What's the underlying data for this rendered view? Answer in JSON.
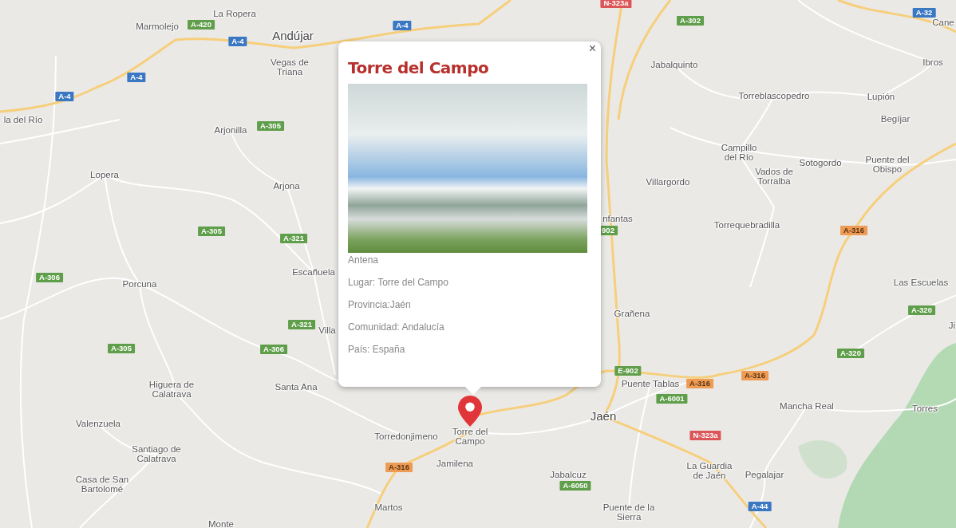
{
  "map": {
    "places": [
      {
        "name": "La Ropera",
        "kind": "town"
      },
      {
        "name": "Marmolejo",
        "kind": "town"
      },
      {
        "name": "Cane",
        "kind": "town"
      },
      {
        "name": "Andújar",
        "kind": "city"
      },
      {
        "name": "Vegas de Triana",
        "kind": "town"
      },
      {
        "name": "Jabalquinto",
        "kind": "town"
      },
      {
        "name": "Ibros",
        "kind": "town"
      },
      {
        "name": "Torreblascopedro",
        "kind": "town"
      },
      {
        "name": "Lupión",
        "kind": "town"
      },
      {
        "name": "la del Río",
        "kind": "town"
      },
      {
        "name": "Begíjar",
        "kind": "town"
      },
      {
        "name": "Arjonilla",
        "kind": "town"
      },
      {
        "name": "Campillo del Río",
        "kind": "town"
      },
      {
        "name": "Sotogordo",
        "kind": "town"
      },
      {
        "name": "Puente del Obispo",
        "kind": "town"
      },
      {
        "name": "Lopera",
        "kind": "town"
      },
      {
        "name": "Arjona",
        "kind": "town"
      },
      {
        "name": "Villargordo",
        "kind": "town"
      },
      {
        "name": "Vados de Torralba",
        "kind": "town"
      },
      {
        "name": "nfantas",
        "kind": "town"
      },
      {
        "name": "Torrequebradilla",
        "kind": "town"
      },
      {
        "name": "Escañuela",
        "kind": "town"
      },
      {
        "name": "Porcuna",
        "kind": "town"
      },
      {
        "name": "Las Escuelas",
        "kind": "town"
      },
      {
        "name": "Grañena",
        "kind": "town"
      },
      {
        "name": "Villa",
        "kind": "town"
      },
      {
        "name": "Ji",
        "kind": "town"
      },
      {
        "name": "Higuera de Calatrava",
        "kind": "town"
      },
      {
        "name": "Santa Ana",
        "kind": "town"
      },
      {
        "name": "Puente Tablas",
        "kind": "town"
      },
      {
        "name": "Mancha Real",
        "kind": "town"
      },
      {
        "name": "Torres",
        "kind": "town"
      },
      {
        "name": "Valenzuela",
        "kind": "town"
      },
      {
        "name": "Jaén",
        "kind": "city"
      },
      {
        "name": "Torredonjimeno",
        "kind": "town"
      },
      {
        "name": "Torre del Campo",
        "kind": "town"
      },
      {
        "name": "Santiago de Calatrava",
        "kind": "town"
      },
      {
        "name": "Jamilena",
        "kind": "town"
      },
      {
        "name": "Jabalcuz",
        "kind": "town"
      },
      {
        "name": "La Guardia de Jaén",
        "kind": "town"
      },
      {
        "name": "Pegalajar",
        "kind": "town"
      },
      {
        "name": "Casa de San Bartolomé",
        "kind": "town"
      },
      {
        "name": "Martos",
        "kind": "town"
      },
      {
        "name": "Puente de la Sierra",
        "kind": "town"
      },
      {
        "name": "Monte",
        "kind": "town"
      }
    ],
    "road_shields": [
      {
        "label": "A-420",
        "color": "#5f9e4a"
      },
      {
        "label": "A-4",
        "color": "#3b78c3"
      },
      {
        "label": "A-4",
        "color": "#3b78c3"
      },
      {
        "label": "A-4",
        "color": "#3b78c3"
      },
      {
        "label": "A-4",
        "color": "#3b78c3"
      },
      {
        "label": "A-305",
        "color": "#5f9e4a"
      },
      {
        "label": "A-305",
        "color": "#5f9e4a"
      },
      {
        "label": "A-321",
        "color": "#5f9e4a"
      },
      {
        "label": "A-306",
        "color": "#5f9e4a"
      },
      {
        "label": "A-321",
        "color": "#5f9e4a"
      },
      {
        "label": "A-305",
        "color": "#5f9e4a"
      },
      {
        "label": "A-306",
        "color": "#5f9e4a"
      },
      {
        "label": "N-323a",
        "color": "#dc5559"
      },
      {
        "label": "A-302",
        "color": "#5f9e4a"
      },
      {
        "label": "A-32",
        "color": "#3b78c3"
      },
      {
        "label": "902",
        "color": "#5f9e4a"
      },
      {
        "label": "A-316",
        "color": "#ee9c55"
      },
      {
        "label": "A-320",
        "color": "#5f9e4a"
      },
      {
        "label": "A-320",
        "color": "#5f9e4a"
      },
      {
        "label": "E-902",
        "color": "#5f9e4a"
      },
      {
        "label": "A-316",
        "color": "#ee9c55"
      },
      {
        "label": "A-316",
        "color": "#ee9c55"
      },
      {
        "label": "A-6001",
        "color": "#5f9e4a"
      },
      {
        "label": "N-323a",
        "color": "#dc5559"
      },
      {
        "label": "A-316",
        "color": "#ee9c55"
      },
      {
        "label": "A-6050",
        "color": "#5f9e4a"
      },
      {
        "label": "A-44",
        "color": "#3b78c3"
      }
    ]
  },
  "popup": {
    "close": "×",
    "title": "Torre del Campo",
    "photo_caption": "Antena",
    "details": [
      "Lugar: Torre del Campo",
      "Provincia:Jaén",
      "Comunidad: Andalucía",
      "País: España"
    ]
  }
}
